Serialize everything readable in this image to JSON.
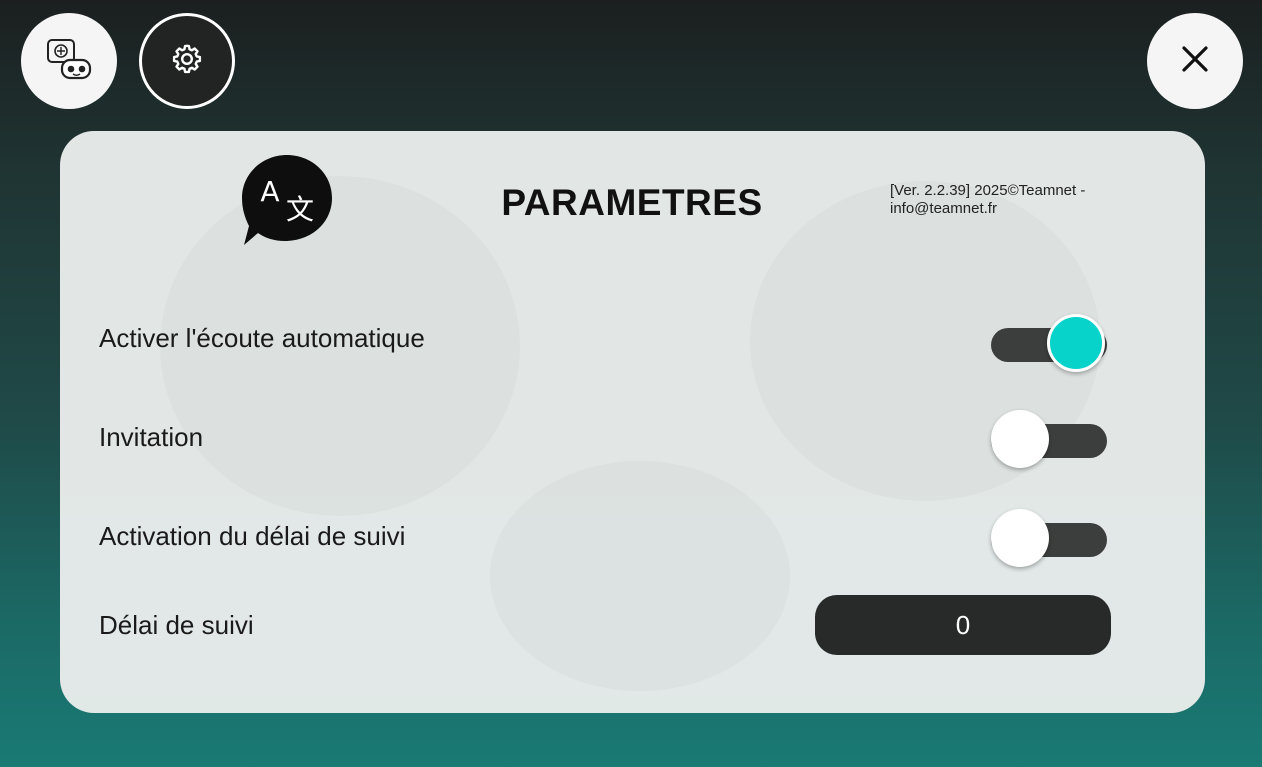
{
  "header": {
    "robot_button_icon": "robot-chat-icon",
    "settings_button_icon": "gear-icon",
    "close_button_icon": "close-icon"
  },
  "panel": {
    "icon": "translate-icon",
    "icon_glyph_latin": "A",
    "icon_glyph_cjk": "文",
    "title": "PARAMETRES",
    "version_text": "[Ver. 2.2.39] 2025©Teamnet - info@teamnet.fr",
    "settings": [
      {
        "label": "Activer l'écoute automatique",
        "enabled": true
      },
      {
        "label": "Invitation",
        "enabled": false
      },
      {
        "label": "Activation du délai de suivi",
        "enabled": false
      }
    ],
    "delay": {
      "label": "Délai de suivi",
      "value": "0"
    }
  },
  "colors": {
    "accent": "#07d3cb",
    "track": "#3c3e3d",
    "input_bg": "#282a29",
    "panel_bg": "#e8eceb"
  }
}
